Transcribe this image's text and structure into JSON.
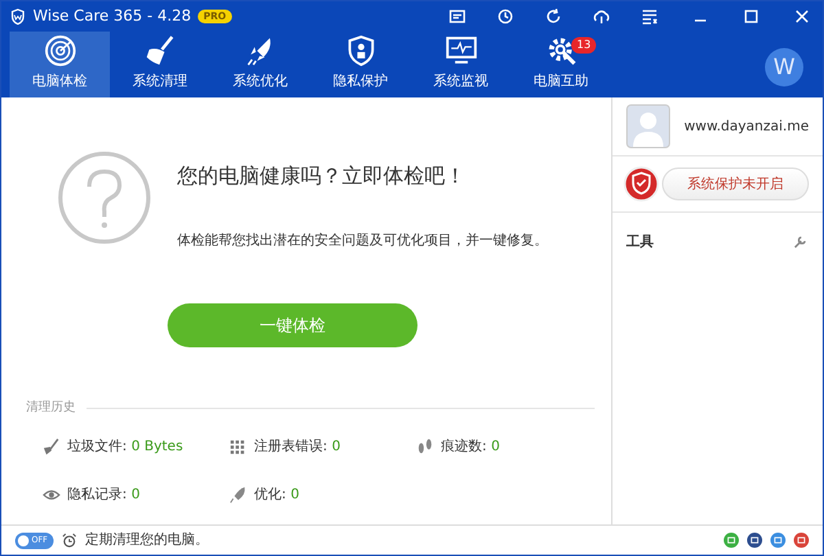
{
  "window": {
    "title": "Wise Care 365 - 4.28",
    "edition_badge": "PRO"
  },
  "tabs": [
    {
      "label": "电脑体检",
      "selected": true
    },
    {
      "label": "系统清理",
      "selected": false
    },
    {
      "label": "系统优化",
      "selected": false
    },
    {
      "label": "隐私保护",
      "selected": false
    },
    {
      "label": "系统监视",
      "selected": false
    },
    {
      "label": "电脑互助",
      "selected": false,
      "badge": "13"
    }
  ],
  "avatar_letter": "W",
  "checkup": {
    "heading": "您的电脑健康吗？立即体检吧！",
    "description": "体检能帮您找出潜在的安全问题及可优化项目，并一键修复。",
    "button": "一键体检"
  },
  "history": {
    "title": "清理历史",
    "items": [
      {
        "label": "垃圾文件:",
        "value": "0 Bytes"
      },
      {
        "label": "注册表错误:",
        "value": "0"
      },
      {
        "label": "痕迹数:",
        "value": "0"
      },
      {
        "label": "隐私记录:",
        "value": "0"
      },
      {
        "label": "优化:",
        "value": "0"
      }
    ]
  },
  "sidebar": {
    "website": "www.dayanzai.me",
    "protection_button": "系统保护未开启",
    "tools_label": "工具"
  },
  "footer": {
    "toggle": {
      "label": "OFF",
      "on": false
    },
    "message": "定期清理您的电脑。"
  }
}
